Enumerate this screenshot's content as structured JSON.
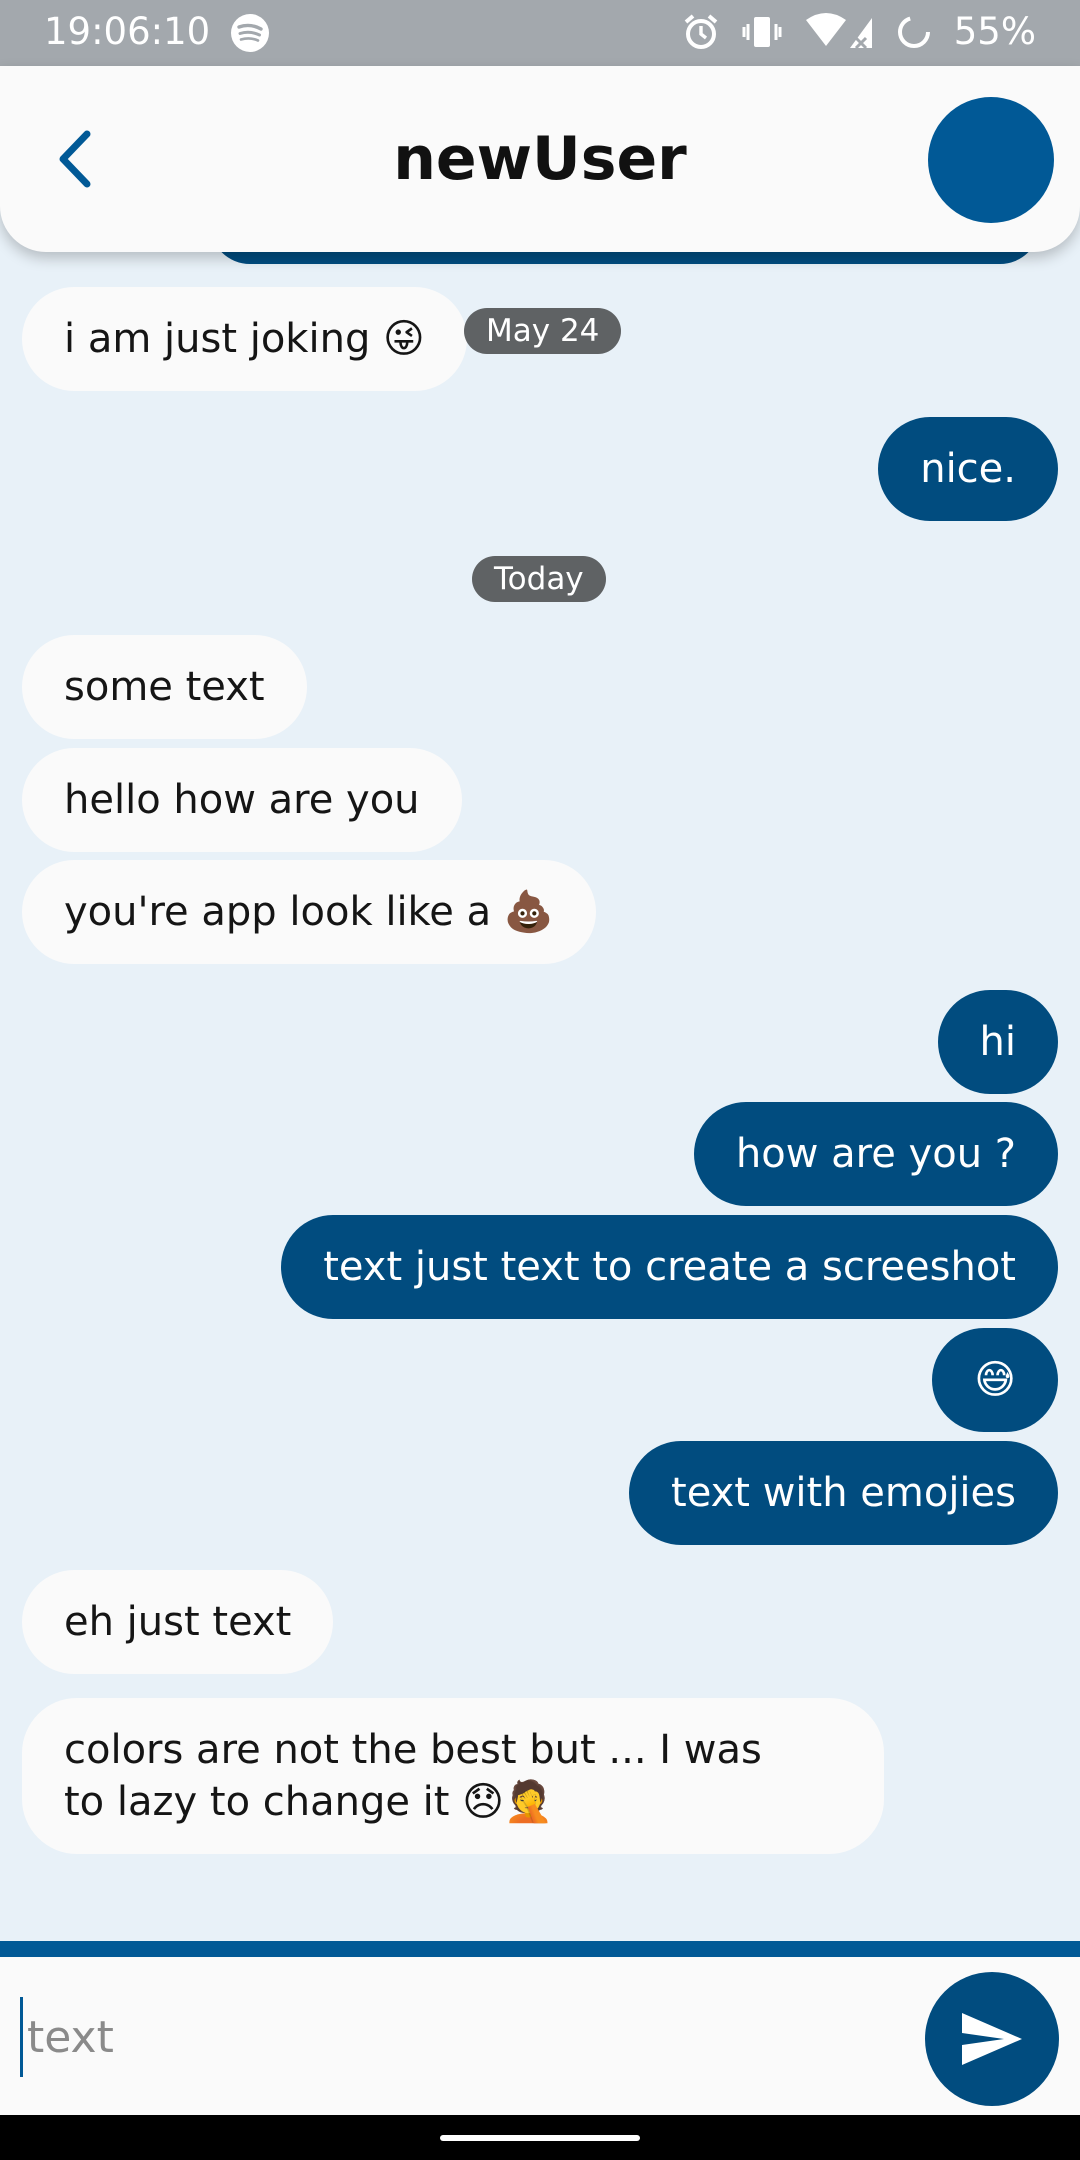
{
  "status_bar": {
    "time": "19:06:10",
    "battery": "55%",
    "icons": [
      "spotify-icon",
      "alarm-icon",
      "vibrate-icon",
      "wifi-icon",
      "no-signal-icon",
      "battery-saver-icon"
    ]
  },
  "header": {
    "title": "newUser",
    "back_icon": "chevron-left-icon",
    "avatar_color": "#015996"
  },
  "dates": {
    "may24": "May 24",
    "today": "Today"
  },
  "messages": [
    {
      "direction": "in",
      "text": "i am just joking",
      "emoji": "😜"
    },
    {
      "direction": "out",
      "text": "nice."
    },
    {
      "direction": "in",
      "text": "some text"
    },
    {
      "direction": "in",
      "text": "hello how are you"
    },
    {
      "direction": "in",
      "text": "you're app look like a",
      "emoji": "💩"
    },
    {
      "direction": "out",
      "text": "hi"
    },
    {
      "direction": "out",
      "text": "how are you ?"
    },
    {
      "direction": "out",
      "text": "text just text to create a screeshot"
    },
    {
      "direction": "out",
      "emoji": "😅"
    },
    {
      "direction": "out",
      "text": "text with emojies"
    },
    {
      "direction": "in",
      "text": "eh just text"
    },
    {
      "direction": "in",
      "text": "colors are not the best but ... I was to lazy to change it",
      "emoji": "😞🤦"
    }
  ],
  "input": {
    "placeholder": "text",
    "value": ""
  },
  "send_icon": "send-icon",
  "colors": {
    "accent": "#014c7f",
    "background": "#e8f1f8",
    "incoming_bubble": "#fafafa",
    "date_chip": "#5f6264"
  }
}
